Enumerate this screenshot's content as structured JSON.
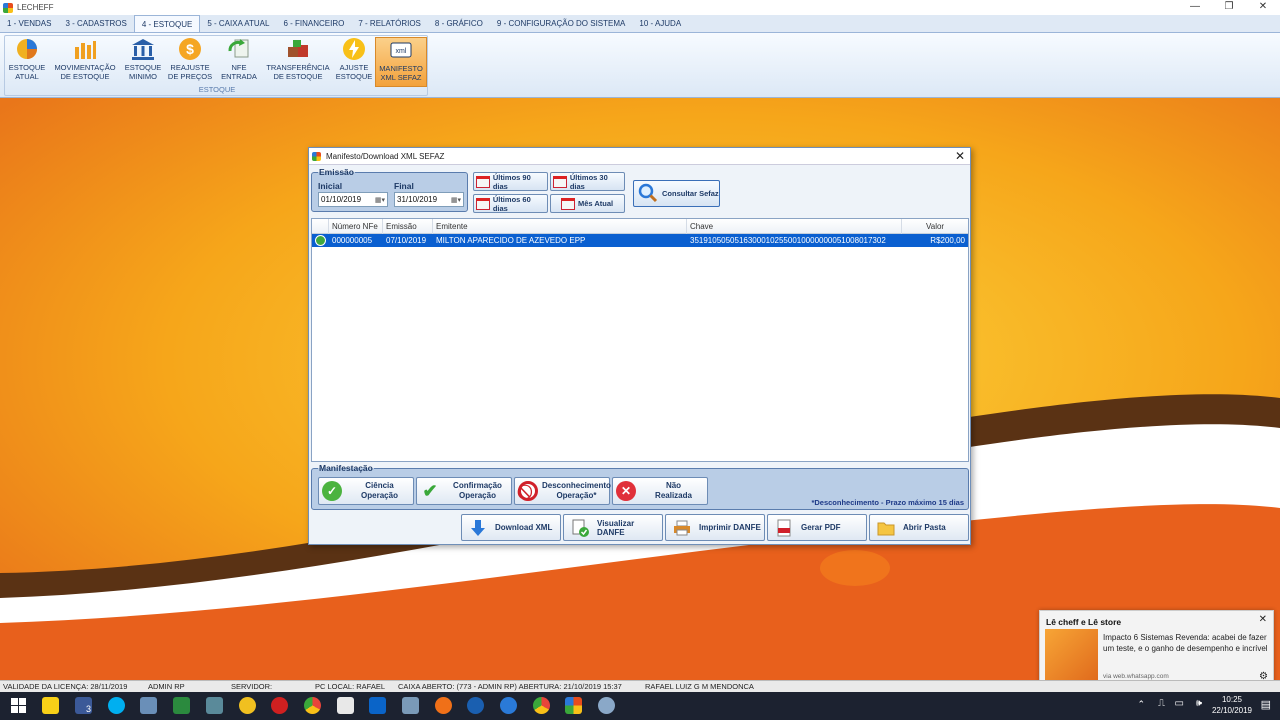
{
  "window": {
    "title": "LECHEFF",
    "controls": [
      "—",
      "❐",
      "✕"
    ]
  },
  "menu": [
    {
      "label": "1 - VENDAS",
      "active": false
    },
    {
      "label": "3 - CADASTROS",
      "active": false
    },
    {
      "label": "4 - ESTOQUE",
      "active": true
    },
    {
      "label": "5 - CAIXA ATUAL",
      "active": false
    },
    {
      "label": "6 - FINANCEIRO",
      "active": false
    },
    {
      "label": "7 - RELATÓRIOS",
      "active": false
    },
    {
      "label": "8 - GRÁFICO",
      "active": false
    },
    {
      "label": "9 - CONFIGURAÇÃO DO SISTEMA",
      "active": false
    },
    {
      "label": "10 - AJUDA",
      "active": false
    }
  ],
  "ribbon": {
    "group_label": "ESTOQUE",
    "buttons": [
      {
        "line1": "ESTOQUE",
        "line2": "ATUAL",
        "icon": "pie-chart-icon"
      },
      {
        "line1": "MOVIMENTAÇÃO",
        "line2": "DE ESTOQUE",
        "icon": "bar-chart-icon"
      },
      {
        "line1": "ESTOQUE",
        "line2": "MINIMO",
        "icon": "bank-icon"
      },
      {
        "line1": "REAJUSTE",
        "line2": "DE PREÇOS",
        "icon": "dollar-coin-icon"
      },
      {
        "line1": "NFE",
        "line2": "ENTRADA",
        "icon": "refresh-document-icon"
      },
      {
        "line1": "TRANSFERÊNCIA",
        "line2": "DE ESTOQUE",
        "icon": "boxes-icon"
      },
      {
        "line1": "AJUSTE",
        "line2": "ESTOQUE",
        "icon": "lightning-icon"
      },
      {
        "line1": "MANIFESTO",
        "line2": "XML SEFAZ",
        "icon": "xml-icon",
        "active": true
      }
    ]
  },
  "dialog": {
    "title": "Manifesto/Download XML SEFAZ",
    "close": "✕",
    "emissao": {
      "legend": "Emissão",
      "inicial_label": "Inicial",
      "inicial_value": "01/10/2019",
      "final_label": "Final",
      "final_value": "31/10/2019"
    },
    "period_buttons": {
      "ultimos90": "Últimos 90 dias",
      "ultimos30": "Últimos 30 dias",
      "ultimos60": "Últimos 60 dias",
      "mes_atual": "Mês Atual"
    },
    "consultar": "Consultar Sefaz",
    "grid": {
      "columns": [
        "Número NFe",
        "Emissão",
        "Emitente",
        "Chave",
        "Valor"
      ],
      "rows": [
        {
          "numero": "000000005",
          "emissao": "07/10/2019",
          "emitente": "MILTON APARECIDO DE AZEVEDO EPP",
          "chave": "35191050505163000102550010000000051008017302",
          "valor": "R$200,00",
          "selected": true
        }
      ]
    },
    "manifestacao": {
      "legend": "Manifestação",
      "ciencia": {
        "l1": "Ciência",
        "l2": "Operação"
      },
      "confirmacao": {
        "l1": "Confirmação",
        "l2": "Operação"
      },
      "desconhecimento": {
        "l1": "Desconhecimento",
        "l2": "Operação*"
      },
      "nao_realizada": {
        "l1": "Não",
        "l2": "Realizada"
      },
      "note": "*Desconhecimento - Prazo máximo 15 dias"
    },
    "actions": {
      "download": "Download XML",
      "visualizar": "Visualizar DANFE",
      "imprimir": "Imprimir DANFE",
      "gerar_pdf": "Gerar PDF",
      "abrir_pasta": "Abrir Pasta"
    }
  },
  "status": {
    "licenca": "VALIDADE DA LICENÇA: 28/11/2019",
    "user": "ADMIN RP",
    "servidor": "SERVIDOR:",
    "pc_local": "PC LOCAL: RAFAEL",
    "caixa": "CAIXA ABERTO: (773 - ADMIN RP) ABERTURA: 21/10/2019 15:37",
    "operador": "RAFAEL LUIZ G M MENDONCA"
  },
  "toast": {
    "title": "Lê cheff e Lê store",
    "body": "Impacto 6 Sistemas Revenda: acabei de fazer um teste, e o ganho de desempenho e incrível",
    "source": "via web.whatsapp.com"
  },
  "taskbar": {
    "time": "10:25",
    "date": "22/10/2019",
    "facebook_badge": "3"
  },
  "colors": {
    "accent": "#0a5fd0",
    "ribbon_active": "#f3a23c",
    "background_orange": "#f4a020"
  }
}
